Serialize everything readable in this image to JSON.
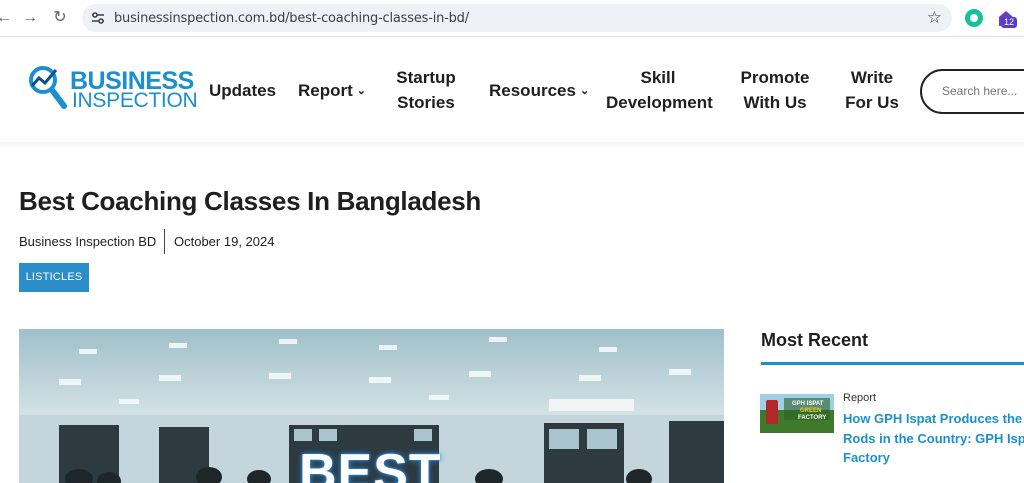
{
  "browser": {
    "url": "businessinspection.com.bd/best-coaching-classes-in-bd/",
    "extension_badge": "12",
    "icons": [
      "back-icon",
      "forward-icon",
      "reload-icon",
      "site-settings-icon",
      "bookmark-star-icon",
      "grammarly-extension-icon",
      "extension-icon"
    ]
  },
  "header": {
    "logo_line1": "BUSINESS",
    "logo_line2": "INSPECTION",
    "menu": [
      {
        "label": "Updates"
      },
      {
        "label": "Report",
        "has_dropdown": true
      },
      {
        "label_line1": "Startup",
        "label_line2": "Stories"
      },
      {
        "label": "Resources",
        "has_dropdown": true
      },
      {
        "label_line1": "Skill",
        "label_line2": "Development"
      },
      {
        "label_line1": "Promote",
        "label_line2": "With Us"
      },
      {
        "label_line1": "Write",
        "label_line2": "For Us"
      }
    ],
    "search_placeholder": "Search here..."
  },
  "article": {
    "title": "Best Coaching Classes In Bangladesh",
    "author": "Business Inspection BD",
    "date": "October 19, 2024",
    "category": "LISTICLES",
    "featured_image_text": "BEST"
  },
  "sidebar": {
    "title": "Most Recent",
    "posts": [
      {
        "category": "Report",
        "title_line1": "How GPH Ispat Produces the St",
        "title_line2": "Rods in the Country: GPH Ispat",
        "title_line3": "Factory",
        "thumb_text_1": "GPH ISPAT",
        "thumb_text_2": "GREEN",
        "thumb_text_3": "FACTORY"
      }
    ]
  },
  "colors": {
    "brand_blue": "#1b8fd0",
    "badge_blue": "#2b8ec8",
    "text_dark": "#1f1f1f"
  }
}
